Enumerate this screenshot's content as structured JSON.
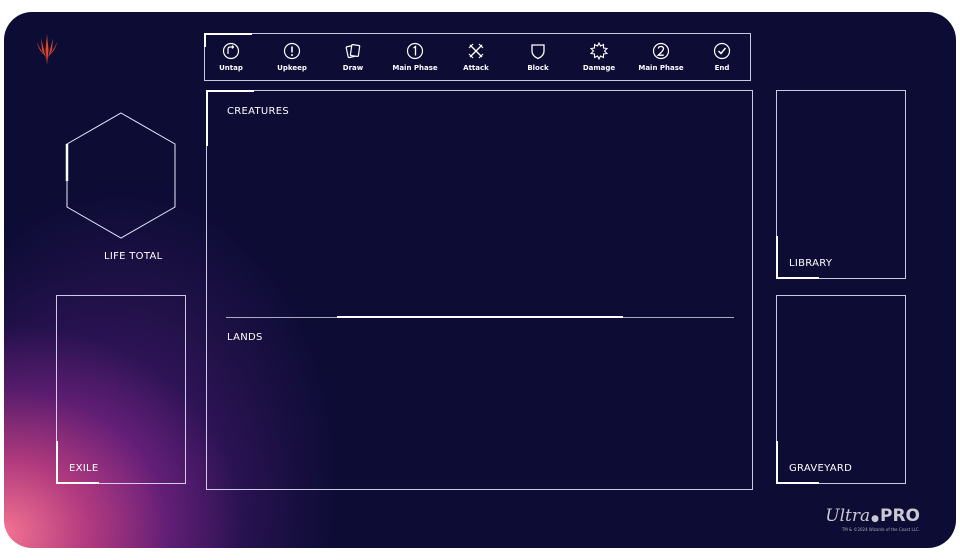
{
  "phases": [
    {
      "label": "Untap",
      "icon": "untap-icon"
    },
    {
      "label": "Upkeep",
      "icon": "upkeep-icon"
    },
    {
      "label": "Draw",
      "icon": "draw-icon"
    },
    {
      "label": "Main Phase",
      "icon": "main-phase-1-icon"
    },
    {
      "label": "Attack",
      "icon": "attack-icon"
    },
    {
      "label": "Block",
      "icon": "block-icon"
    },
    {
      "label": "Damage",
      "icon": "damage-icon"
    },
    {
      "label": "Main Phase",
      "icon": "main-phase-2-icon"
    },
    {
      "label": "End",
      "icon": "end-icon"
    }
  ],
  "zones": {
    "life_total": "LIFE TOTAL",
    "creatures": "CREATURES",
    "lands": "LANDS",
    "exile": "EXILE",
    "library": "LIBRARY",
    "graveyard": "GRAVEYARD"
  },
  "brand": {
    "name_ultra": "Ultra",
    "name_pro": "PRO",
    "copyright": "TM & ©2024 Wizards of the Coast LLC."
  },
  "colors": {
    "background": "#0c0c35",
    "line": "#ebebff",
    "glow": "#ff7896",
    "logo_accent": "#e0462a"
  }
}
